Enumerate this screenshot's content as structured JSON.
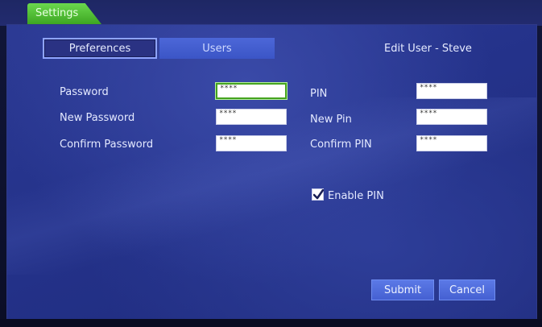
{
  "tabs": {
    "settings_label": "Settings"
  },
  "subtabs": {
    "preferences": "Preferences",
    "users": "Users"
  },
  "header": {
    "edit_title": "Edit User - Steve"
  },
  "form": {
    "password_label": "Password",
    "password_value": "****",
    "new_password_label": "New Password",
    "new_password_value": "****",
    "confirm_password_label": "Confirm Password",
    "confirm_password_value": "****",
    "pin_label": "PIN",
    "pin_value": "****",
    "new_pin_label": "New Pin",
    "new_pin_value": "****",
    "confirm_pin_label": "Confirm PIN",
    "confirm_pin_value": "****",
    "enable_pin_label": "Enable PIN",
    "enable_pin_checked": true
  },
  "actions": {
    "submit_label": "Submit",
    "cancel_label": "Cancel"
  },
  "colors": {
    "accent_green": "#45a31f",
    "panel_blue": "#2c3a94",
    "button_blue": "#4560d2"
  }
}
